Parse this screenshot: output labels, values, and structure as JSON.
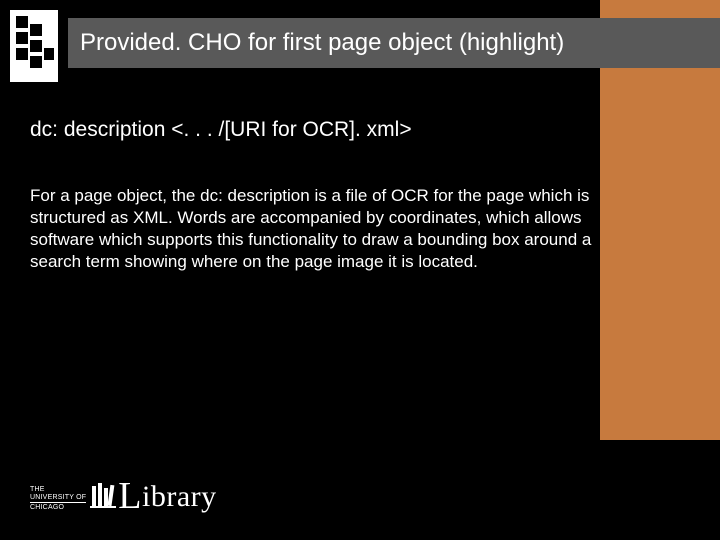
{
  "header": {
    "title": "Provided. CHO for first page object (highlight)"
  },
  "subtitle": "dc: description <. . . /[URI for OCR]. xml>",
  "body": "For a page object, the dc: description is a file of OCR for the page which is structured as XML. Words are accompanied by coordinates, which allows software which supports this functionality to draw a bounding box around a search term showing where on the page image it is located.",
  "footer": {
    "institution_line1": "THE",
    "institution_line2": "UNIVERSITY OF",
    "institution_line3": "CHICAGO",
    "library_word": "Library"
  }
}
